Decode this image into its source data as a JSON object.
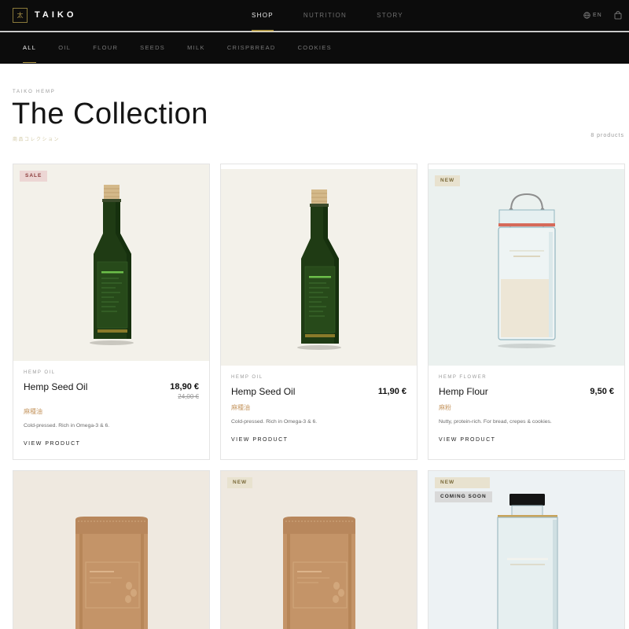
{
  "header": {
    "logo_glyph": "太",
    "brand": "TAIKO",
    "nav": [
      "SHOP",
      "NUTRITION",
      "STORY"
    ],
    "active_nav": "SHOP",
    "language": "EN",
    "accent_color": "#b39b4a"
  },
  "categories": [
    "ALL",
    "OIL",
    "FLOUR",
    "SEEDS",
    "MILK",
    "CRISPBREAD",
    "COOKIES"
  ],
  "active_category": "ALL",
  "page": {
    "eyebrow": "TAIKO HEMP",
    "title": "The Collection",
    "subtitle": "商品コレクション",
    "count": "8 products"
  },
  "products": [
    {
      "badges": [
        "SALE"
      ],
      "category": "HEMP OIL",
      "name": "Hemp Seed Oil",
      "price": "18,90 €",
      "old_price": "24,00 €",
      "jp_name": "麻種油",
      "description": "Cold-pressed. Rich in Omega-3 & 6.",
      "cta": "VIEW PRODUCT",
      "image": "oil-bottle"
    },
    {
      "badges": [],
      "category": "HEMP OIL",
      "name": "Hemp Seed Oil",
      "price": "11,90 €",
      "old_price": "",
      "jp_name": "麻種油",
      "description": "Cold-pressed. Rich in Omega-3 & 6.",
      "cta": "VIEW PRODUCT",
      "image": "oil-bottle"
    },
    {
      "badges": [
        "NEW"
      ],
      "category": "HEMP FLOWER",
      "name": "Hemp Flour",
      "price": "9,50 €",
      "old_price": "",
      "jp_name": "麻粉",
      "description": "Nutty, protein-rich. For bread, crepes & cookies.",
      "cta": "VIEW PRODUCT",
      "image": "flour-jar"
    },
    {
      "badges": [],
      "image": "seed-pouch"
    },
    {
      "badges": [
        "NEW"
      ],
      "image": "seed-pouch"
    },
    {
      "badges": [
        "NEW",
        "COMING SOON"
      ],
      "image": "milk-bottle"
    }
  ]
}
